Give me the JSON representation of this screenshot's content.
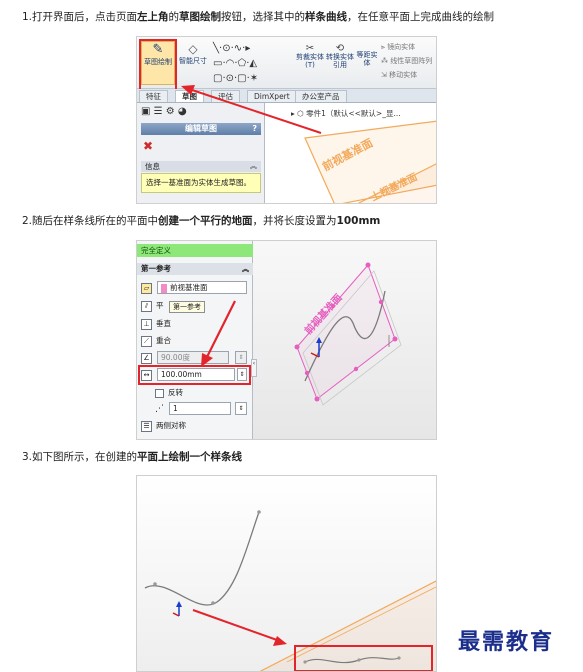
{
  "steps": [
    {
      "parts": [
        {
          "text": "1.打开界面后，点击页面",
          "bold": false
        },
        {
          "text": "左上角",
          "bold": true
        },
        {
          "text": "的",
          "bold": false
        },
        {
          "text": "草图绘制",
          "bold": true
        },
        {
          "text": "按钮，选择其中的",
          "bold": false
        },
        {
          "text": "样条曲线",
          "bold": true
        },
        {
          "text": "，在任意平面上完成曲线的绘制",
          "bold": false
        }
      ]
    },
    {
      "parts": [
        {
          "text": "2.随后在样条线所在的平面中",
          "bold": false
        },
        {
          "text": "创建一个平行的地面",
          "bold": true
        },
        {
          "text": "，并将长度设置为",
          "bold": false
        },
        {
          "text": "100mm",
          "bold": true
        }
      ]
    },
    {
      "parts": [
        {
          "text": "3.如下图所示，在创建的",
          "bold": false
        },
        {
          "text": "平面上",
          "bold": true
        },
        {
          "text": "绘制一个样条线",
          "bold": true
        }
      ]
    }
  ],
  "shot1": {
    "ribbon": {
      "sketch_button": "草图绘制",
      "smart_dim_button": "智能尺寸",
      "trim_button": "剪裁实体(T)",
      "convert_button": "转换实体引用",
      "offset_button": "等距实体",
      "mirror_button": "镜向实体",
      "linear_pattern_button": "线性草图阵列",
      "move_button": "移动实体"
    },
    "tabs": [
      "特征",
      "草图",
      "评估",
      "DimXpert",
      "办公室产品"
    ],
    "active_tab": "草图",
    "panel_title": "编辑草图",
    "panel_help": "?",
    "info_header": "信息",
    "info_message": "选择一基准面为实体生成草图。",
    "tree_label": "零件1（默认<<默认>_显...",
    "plane_labels": [
      "前视基准面",
      "上视基准面"
    ],
    "colors": {
      "highlight": "#e3242b",
      "plane": "#f3a95a",
      "info_bg": "#ffffb8"
    }
  },
  "shot2": {
    "status": "完全定义",
    "first_reference_header": "第一参考",
    "first_reference_value": "前视基准面",
    "parallel_label": "平",
    "parallel_tooltip": "第一参考",
    "perpendicular_label": "垂直",
    "coincident_label": "重合",
    "angle_value": "90.00度",
    "distance_value": "100.00mm",
    "flip_label": "反转",
    "count_value": "1",
    "mid_plane_label": "两侧对称",
    "plane_label": "前视基准面",
    "colors": {
      "status": "#8de879",
      "plane_edges": "#e65fc0"
    }
  },
  "shot3": {
    "colors": {
      "plane": "#f3a95a"
    }
  },
  "watermark": "最需教育"
}
